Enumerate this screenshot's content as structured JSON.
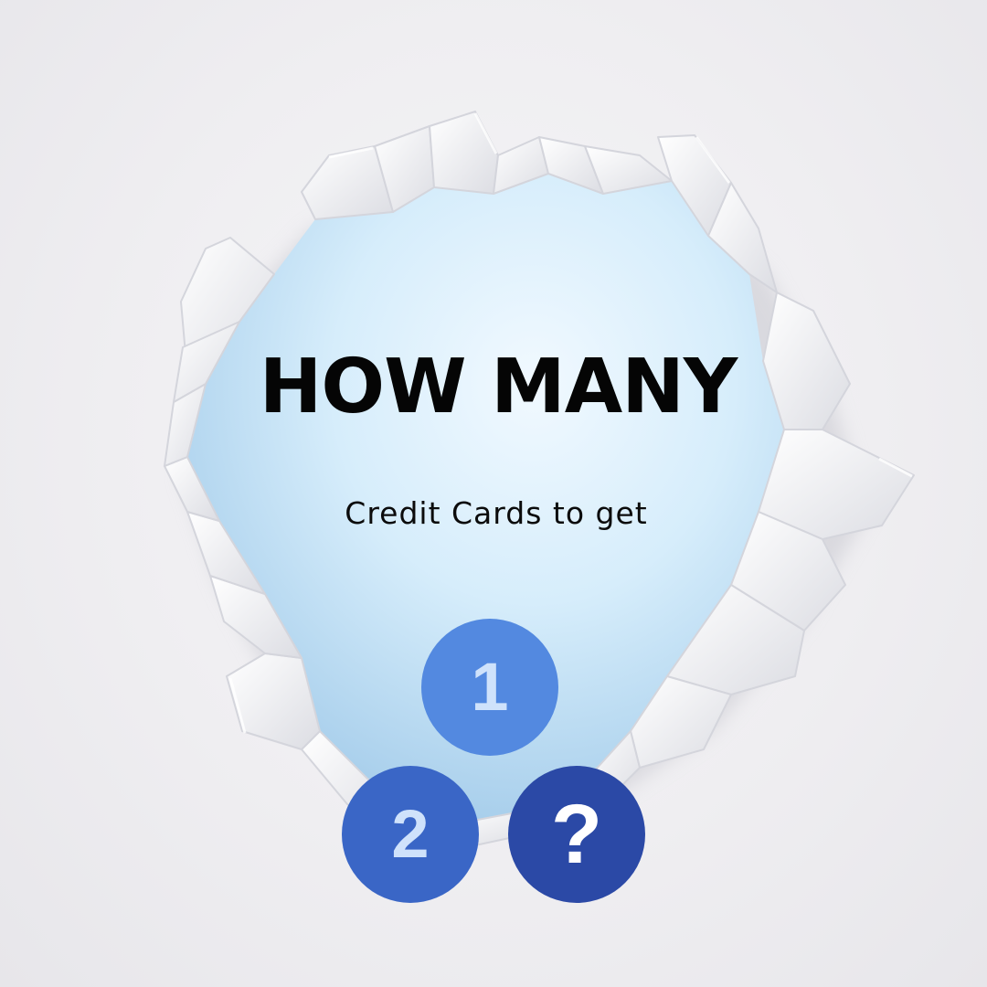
{
  "headline": "HOW MANY",
  "subline": "Credit Cards to get",
  "badges": [
    {
      "label": "1",
      "color": "#5389e0"
    },
    {
      "label": "2",
      "color": "#3a66c6"
    },
    {
      "label": "?",
      "color": "#2b49a6"
    }
  ],
  "colors": {
    "paper": "#efeef1",
    "hole": "#c9e6f7",
    "text": "#050505"
  }
}
